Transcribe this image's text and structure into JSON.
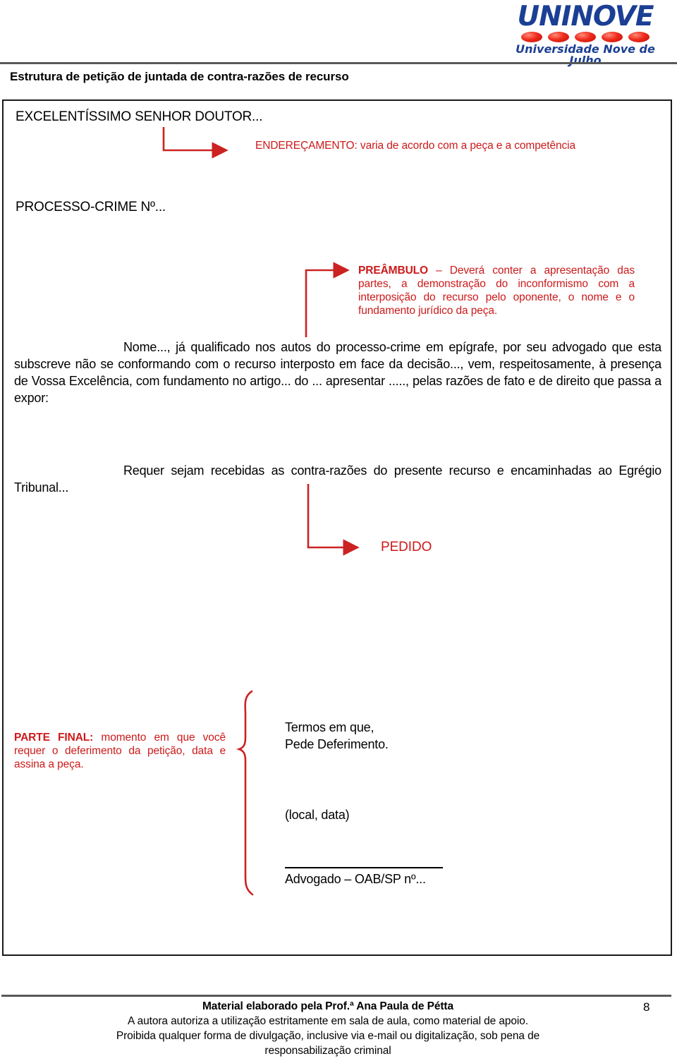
{
  "logo": {
    "wordmark": "UNINOVE",
    "tagline": "Universidade Nove de Julho",
    "dot_count": 5,
    "brand_blue": "#1b3f94",
    "brand_red": "#ee2b1c"
  },
  "header": {
    "title": "Estrutura de petição de juntada de contra-razões de recurso"
  },
  "accent_red": "#cc1a1a",
  "document": {
    "addressee_line": "EXCELENTÍSSIMO SENHOR DOUTOR...",
    "case_line": "PROCESSO-CRIME Nº...",
    "annotation_enderecamento": "ENDEREÇAMENTO: varia de acordo com a peça e a competência",
    "annotation_preambulo_label": "PREÂMBULO",
    "annotation_preambulo_text": " – Deverá conter a apresentação das partes, a demonstração do inconformismo com a interposição do recurso pelo oponente, o nome e o fundamento jurídico da peça.",
    "qualification_paragraph": "Nome..., já qualificado nos autos do processo-crime em epígrafe, por seu advogado que esta subscreve não se conformando com o recurso interposto em face da decisão..., vem, respeitosamente, à presença de Vossa Excelência, com fundamento no artigo... do ... apresentar ....., pelas razões de fato e de direito que passa a expor:",
    "request_paragraph": "Requer sejam recebidas as contra-razões do presente recurso e encaminhadas ao Egrégio Tribunal...",
    "annotation_pedido": "PEDIDO",
    "annotation_parte_final_label": "PARTE FINAL:",
    "annotation_parte_final_text": " momento em que você requer o deferimento da petição, data e assina a peça.",
    "closing_line_1": "Termos em que,",
    "closing_line_2": "Pede Deferimento.",
    "place_date": "(local, data)",
    "signature_caption": "Advogado – OAB/SP nº..."
  },
  "footer": {
    "line1": "Material elaborado pela Prof.ª Ana Paula de Pétta",
    "line2": "A autora autoriza a utilização estritamente em sala de aula, como material de apoio.",
    "line3": "Proibida qualquer forma de divulgação, inclusive via e-mail ou digitalização, sob pena de",
    "line4": "responsabilização criminal",
    "page_number": "8"
  }
}
